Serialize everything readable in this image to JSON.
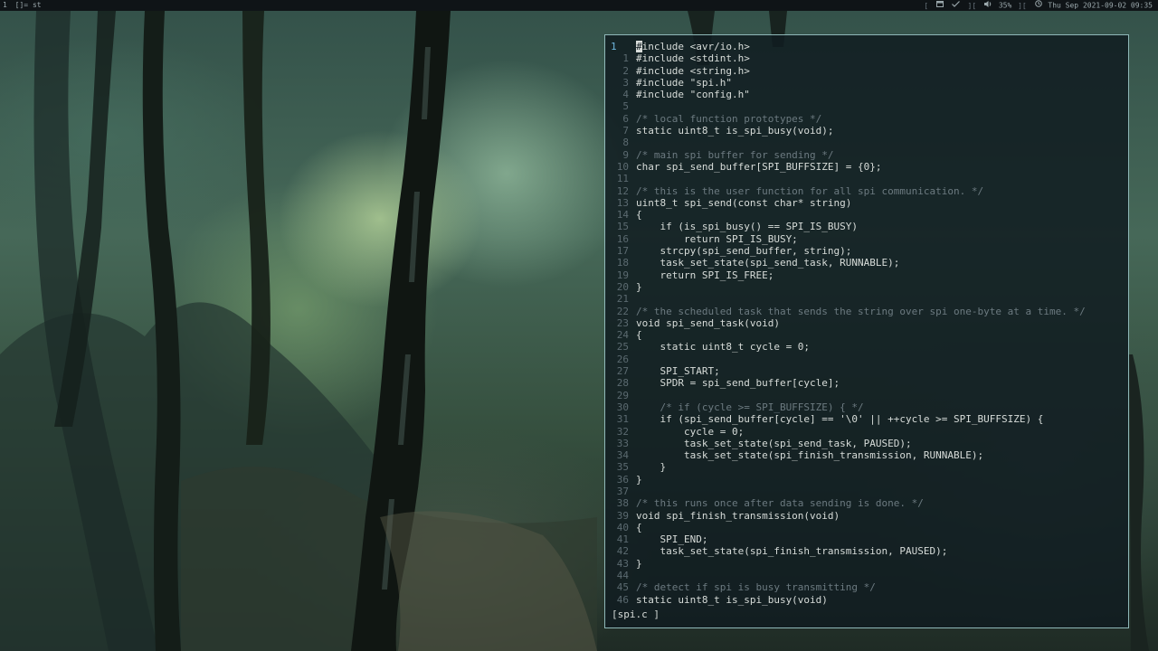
{
  "topbar": {
    "tag": "1",
    "layout": "[]=",
    "window_title": "st",
    "battery": "35%",
    "datetime": "Thu Sep 2021-09-02 09:35",
    "icons": [
      "window-icon",
      "check-icon",
      "volume-icon",
      "battery-icon",
      "clock-icon"
    ]
  },
  "editor": {
    "status": "[spi.c ]",
    "current_line": "1",
    "cursor_char": "#",
    "lines": [
      {
        "n": "1",
        "text": "include <avr/io.h>",
        "current": true,
        "cursor": true
      },
      {
        "n": "1",
        "text": "#include <stdint.h>"
      },
      {
        "n": "2",
        "text": "#include <string.h>"
      },
      {
        "n": "3",
        "text": "#include \"spi.h\""
      },
      {
        "n": "4",
        "text": "#include \"config.h\""
      },
      {
        "n": "5",
        "text": ""
      },
      {
        "n": "6",
        "text": "/* local function prototypes */",
        "comment": true
      },
      {
        "n": "7",
        "text": "static uint8_t is_spi_busy(void);"
      },
      {
        "n": "8",
        "text": ""
      },
      {
        "n": "9",
        "text": "/* main spi buffer for sending */",
        "comment": true
      },
      {
        "n": "10",
        "text": "char spi_send_buffer[SPI_BUFFSIZE] = {0};"
      },
      {
        "n": "11",
        "text": ""
      },
      {
        "n": "12",
        "text": "/* this is the user function for all spi communication. */",
        "comment": true
      },
      {
        "n": "13",
        "text": "uint8_t spi_send(const char* string)"
      },
      {
        "n": "14",
        "text": "{"
      },
      {
        "n": "15",
        "text": "    if (is_spi_busy() == SPI_IS_BUSY)"
      },
      {
        "n": "16",
        "text": "        return SPI_IS_BUSY;"
      },
      {
        "n": "17",
        "text": "    strcpy(spi_send_buffer, string);"
      },
      {
        "n": "18",
        "text": "    task_set_state(spi_send_task, RUNNABLE);"
      },
      {
        "n": "19",
        "text": "    return SPI_IS_FREE;"
      },
      {
        "n": "20",
        "text": "}"
      },
      {
        "n": "21",
        "text": ""
      },
      {
        "n": "22",
        "text": "/* the scheduled task that sends the string over spi one-byte at a time. */",
        "comment": true
      },
      {
        "n": "23",
        "text": "void spi_send_task(void)"
      },
      {
        "n": "24",
        "text": "{"
      },
      {
        "n": "25",
        "text": "    static uint8_t cycle = 0;"
      },
      {
        "n": "26",
        "text": ""
      },
      {
        "n": "27",
        "text": "    SPI_START;"
      },
      {
        "n": "28",
        "text": "    SPDR = spi_send_buffer[cycle];"
      },
      {
        "n": "29",
        "text": ""
      },
      {
        "n": "30",
        "text": "    /* if (cycle >= SPI_BUFFSIZE) { */",
        "comment": true
      },
      {
        "n": "31",
        "text": "    if (spi_send_buffer[cycle] == '\\0' || ++cycle >= SPI_BUFFSIZE) {"
      },
      {
        "n": "32",
        "text": "        cycle = 0;"
      },
      {
        "n": "33",
        "text": "        task_set_state(spi_send_task, PAUSED);"
      },
      {
        "n": "34",
        "text": "        task_set_state(spi_finish_transmission, RUNNABLE);"
      },
      {
        "n": "35",
        "text": "    }"
      },
      {
        "n": "36",
        "text": "}"
      },
      {
        "n": "37",
        "text": ""
      },
      {
        "n": "38",
        "text": "/* this runs once after data sending is done. */",
        "comment": true
      },
      {
        "n": "39",
        "text": "void spi_finish_transmission(void)"
      },
      {
        "n": "40",
        "text": "{"
      },
      {
        "n": "41",
        "text": "    SPI_END;"
      },
      {
        "n": "42",
        "text": "    task_set_state(spi_finish_transmission, PAUSED);"
      },
      {
        "n": "43",
        "text": "}"
      },
      {
        "n": "44",
        "text": ""
      },
      {
        "n": "45",
        "text": "/* detect if spi is busy transmitting */",
        "comment": true
      },
      {
        "n": "46",
        "text": "static uint8_t is_spi_busy(void)"
      }
    ]
  },
  "colors": {
    "terminal_border": "#8fb8b8",
    "comment": "#6c7a80",
    "line_number": "#5b6a70",
    "current_line_number": "#6fb7de"
  }
}
